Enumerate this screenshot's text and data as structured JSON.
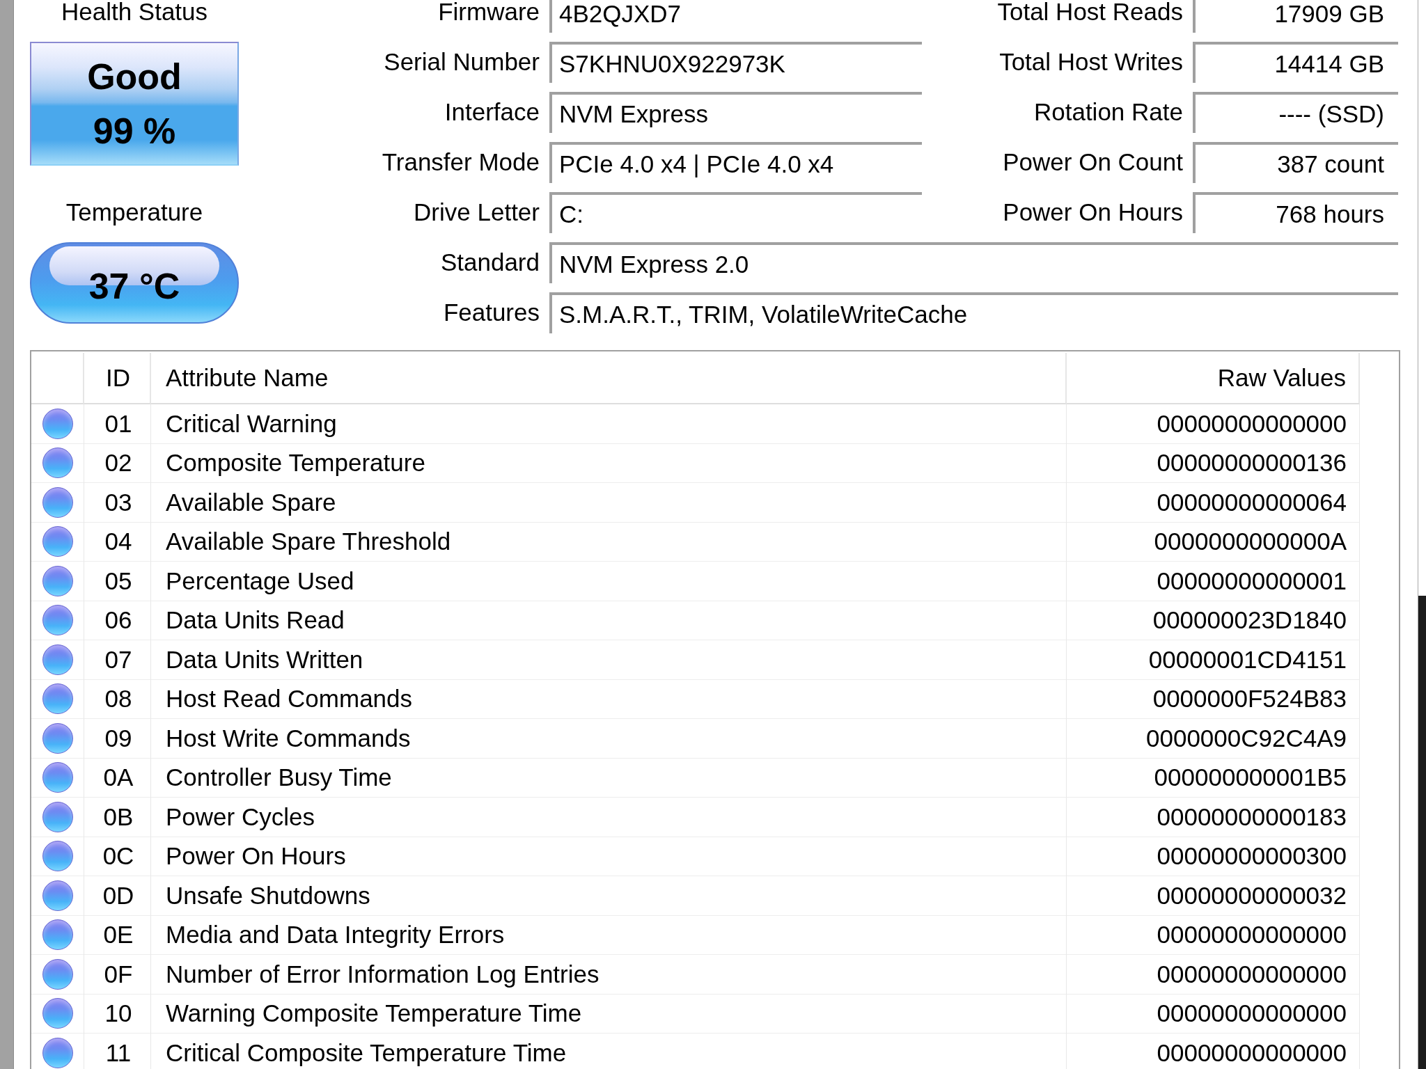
{
  "health_status": {
    "label": "Health Status",
    "status": "Good",
    "percentage": "99 %"
  },
  "temperature": {
    "label": "Temperature",
    "value": "37 °C"
  },
  "drive_info": [
    {
      "fields": [
        {
          "label": "Firmware",
          "value": "4B2QJXD7"
        },
        {
          "label": "Total Host Reads",
          "value": "17909 GB"
        }
      ]
    },
    {
      "fields": [
        {
          "label": "Serial Number",
          "value": "S7KHNU0X922973K"
        },
        {
          "label": "Total Host Writes",
          "value": "14414 GB"
        }
      ]
    },
    {
      "fields": [
        {
          "label": "Interface",
          "value": "NVM Express"
        },
        {
          "label": "Rotation Rate",
          "value": "---- (SSD)"
        }
      ]
    },
    {
      "fields": [
        {
          "label": "Transfer Mode",
          "value": "PCIe 4.0 x4 | PCIe 4.0 x4"
        },
        {
          "label": "Power On Count",
          "value": "387 count"
        }
      ]
    },
    {
      "fields": [
        {
          "label": "Drive Letter",
          "value": "C:"
        },
        {
          "label": "Power On Hours",
          "value": "768 hours"
        }
      ]
    },
    {
      "fields": [
        {
          "label": "Standard",
          "value": "NVM Express 2.0"
        }
      ]
    },
    {
      "fields": [
        {
          "label": "Features",
          "value": "S.M.A.R.T., TRIM, VolatileWriteCache"
        }
      ]
    }
  ],
  "smart_table": {
    "columns": [
      "ID",
      "Attribute Name",
      "Raw Values"
    ],
    "rows": [
      {
        "id": "01",
        "attribute": "Critical Warning",
        "raw_value": "00000000000000"
      },
      {
        "id": "02",
        "attribute": "Composite Temperature",
        "raw_value": "00000000000136"
      },
      {
        "id": "03",
        "attribute": "Available Spare",
        "raw_value": "00000000000064"
      },
      {
        "id": "04",
        "attribute": "Available Spare Threshold",
        "raw_value": "0000000000000A"
      },
      {
        "id": "05",
        "attribute": "Percentage Used",
        "raw_value": "00000000000001"
      },
      {
        "id": "06",
        "attribute": "Data Units Read",
        "raw_value": "000000023D1840"
      },
      {
        "id": "07",
        "attribute": "Data Units Written",
        "raw_value": "00000001CD4151"
      },
      {
        "id": "08",
        "attribute": "Host Read Commands",
        "raw_value": "0000000F524B83"
      },
      {
        "id": "09",
        "attribute": "Host Write Commands",
        "raw_value": "0000000C92C4A9"
      },
      {
        "id": "0A",
        "attribute": "Controller Busy Time",
        "raw_value": "000000000001B5"
      },
      {
        "id": "0B",
        "attribute": "Power Cycles",
        "raw_value": "00000000000183"
      },
      {
        "id": "0C",
        "attribute": "Power On Hours",
        "raw_value": "00000000000300"
      },
      {
        "id": "0D",
        "attribute": "Unsafe Shutdowns",
        "raw_value": "00000000000032"
      },
      {
        "id": "0E",
        "attribute": "Media and Data Integrity Errors",
        "raw_value": "00000000000000"
      },
      {
        "id": "0F",
        "attribute": "Number of Error Information Log Entries",
        "raw_value": "00000000000000"
      },
      {
        "id": "10",
        "attribute": "Warning Composite Temperature Time",
        "raw_value": "00000000000000"
      },
      {
        "id": "11",
        "attribute": "Critical Composite Temperature Time",
        "raw_value": "00000000000000"
      }
    ]
  }
}
